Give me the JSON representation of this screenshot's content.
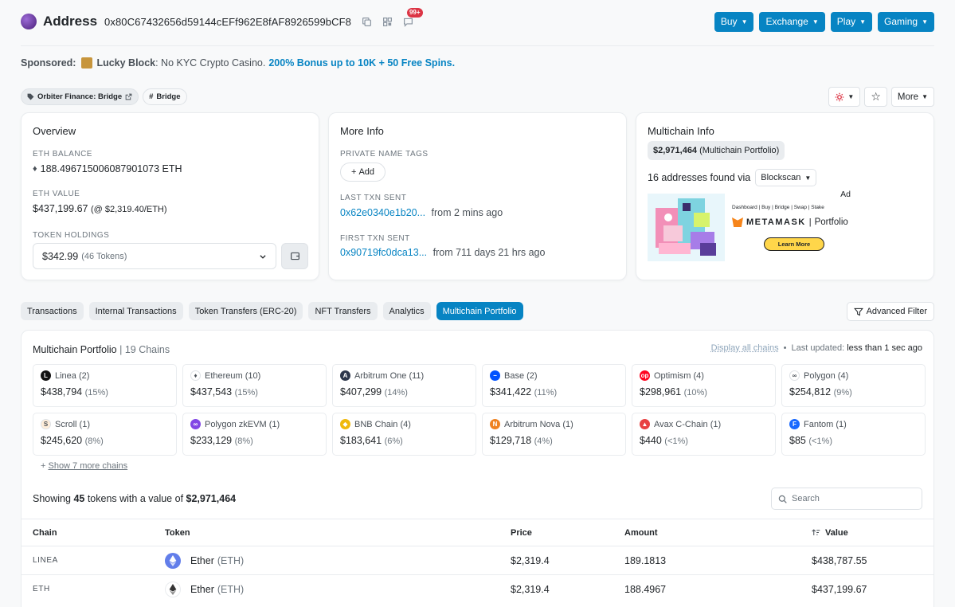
{
  "header": {
    "title": "Address",
    "address": "0x80C67432656d59144cEFf962E8fAF8926599bCF8",
    "notif_badge": "99+",
    "buttons": [
      "Buy",
      "Exchange",
      "Play",
      "Gaming"
    ]
  },
  "sponsored": {
    "label": "Sponsored:",
    "brand": "Lucky Block",
    "text": ": No KYC Crypto Casino.",
    "link": "200% Bonus up to 10K + 50 Free Spins."
  },
  "tags": {
    "tag1": "Orbiter Finance: Bridge",
    "tag2": "Bridge",
    "more": "More"
  },
  "overview": {
    "title": "Overview",
    "eth_balance_label": "ETH BALANCE",
    "eth_balance": "188.496715006087901073 ETH",
    "eth_value_label": "ETH VALUE",
    "eth_value": "$437,199.67",
    "eth_rate": "(@ $2,319.40/ETH)",
    "holdings_label": "TOKEN HOLDINGS",
    "holdings_value": "$342.99",
    "holdings_count": "(46 Tokens)"
  },
  "more_info": {
    "title": "More Info",
    "tags_label": "PRIVATE NAME TAGS",
    "add_label": "Add",
    "last_sent_label": "LAST TXN SENT",
    "last_sent_hash": "0x62e0340e1b20...",
    "last_sent_time": "from 2 mins ago",
    "first_sent_label": "FIRST TXN SENT",
    "first_sent_hash": "0x90719fc0dca13...",
    "first_sent_time": "from 711 days 21 hrs ago"
  },
  "multichain": {
    "title": "Multichain Info",
    "portfolio_value": "$2,971,464",
    "portfolio_suffix": "(Multichain Portfolio)",
    "found_text": "16 addresses found via",
    "found_source": "Blockscan",
    "ad_label": "Ad",
    "ad_menu": "Dashboard | Buy | Bridge | Swap | Stake",
    "ad_brand": "METAMASK",
    "ad_product": "Portfolio",
    "ad_cta": "Learn More"
  },
  "tabs": [
    {
      "label": "Transactions",
      "active": false
    },
    {
      "label": "Internal Transactions",
      "active": false
    },
    {
      "label": "Token Transfers (ERC-20)",
      "active": false
    },
    {
      "label": "NFT Transfers",
      "active": false
    },
    {
      "label": "Analytics",
      "active": false
    },
    {
      "label": "Multichain Portfolio",
      "active": true
    }
  ],
  "advanced_filter": "Advanced Filter",
  "portfolio": {
    "title": "Multichain Portfolio",
    "chains_count": "19 Chains",
    "display_all": "Display all chains",
    "last_updated_label": "Last updated:",
    "last_updated_value": "less than 1 sec ago",
    "chains": [
      {
        "name": "Linea (2)",
        "value": "$438,794",
        "pct": "(15%)",
        "icon": "linea-icon",
        "color": "#121212",
        "glyph": "L"
      },
      {
        "name": "Ethereum (10)",
        "value": "$437,543",
        "pct": "(15%)",
        "icon": "ethereum-icon",
        "color": "#ffffff",
        "glyph": "♦"
      },
      {
        "name": "Arbitrum One (11)",
        "value": "$407,299",
        "pct": "(14%)",
        "icon": "arbitrum-icon",
        "color": "#2d374b",
        "glyph": "A"
      },
      {
        "name": "Base (2)",
        "value": "$341,422",
        "pct": "(11%)",
        "icon": "base-icon",
        "color": "#0052ff",
        "glyph": "−"
      },
      {
        "name": "Optimism (4)",
        "value": "$298,961",
        "pct": "(10%)",
        "icon": "optimism-icon",
        "color": "#ff0420",
        "glyph": "op"
      },
      {
        "name": "Polygon (4)",
        "value": "$254,812",
        "pct": "(9%)",
        "icon": "polygon-icon",
        "color": "#ffffff",
        "glyph": "∞"
      },
      {
        "name": "Scroll (1)",
        "value": "$245,620",
        "pct": "(8%)",
        "icon": "scroll-icon",
        "color": "#ffeeda",
        "glyph": "S"
      },
      {
        "name": "Polygon zkEVM (1)",
        "value": "$233,129",
        "pct": "(8%)",
        "icon": "polygon-zkevm-icon",
        "color": "#8247e5",
        "glyph": "∞"
      },
      {
        "name": "BNB Chain (4)",
        "value": "$183,641",
        "pct": "(6%)",
        "icon": "bnb-icon",
        "color": "#f0b90b",
        "glyph": "◆"
      },
      {
        "name": "Arbitrum Nova (1)",
        "value": "$129,718",
        "pct": "(4%)",
        "icon": "arbitrum-nova-icon",
        "color": "#ef8220",
        "glyph": "N"
      },
      {
        "name": "Avax C-Chain (1)",
        "value": "$440",
        "pct": "(<1%)",
        "icon": "avax-icon",
        "color": "#e84142",
        "glyph": "▲"
      },
      {
        "name": "Fantom (1)",
        "value": "$85",
        "pct": "(<1%)",
        "icon": "fantom-icon",
        "color": "#1969ff",
        "glyph": "F"
      }
    ],
    "show_more": "Show 7 more chains",
    "showing_prefix": "Showing",
    "showing_count": "45",
    "showing_mid": "tokens with a value of",
    "showing_total": "$2,971,464",
    "search_placeholder": "Search"
  },
  "table": {
    "headers": {
      "chain": "Chain",
      "token": "Token",
      "price": "Price",
      "amount": "Amount",
      "value": "Value"
    },
    "rows": [
      {
        "chain": "LINEA",
        "token": "Ether",
        "symbol": "(ETH)",
        "price": "$2,319.4",
        "amount": "189.1813",
        "value": "$438,787.55",
        "icon": "eth-icon",
        "icon_color": "#627eea"
      },
      {
        "chain": "ETH",
        "token": "Ether",
        "symbol": "(ETH)",
        "price": "$2,319.4",
        "amount": "188.4967",
        "value": "$437,199.67",
        "icon": "eth-icon",
        "icon_color": "#ffffff"
      }
    ]
  }
}
